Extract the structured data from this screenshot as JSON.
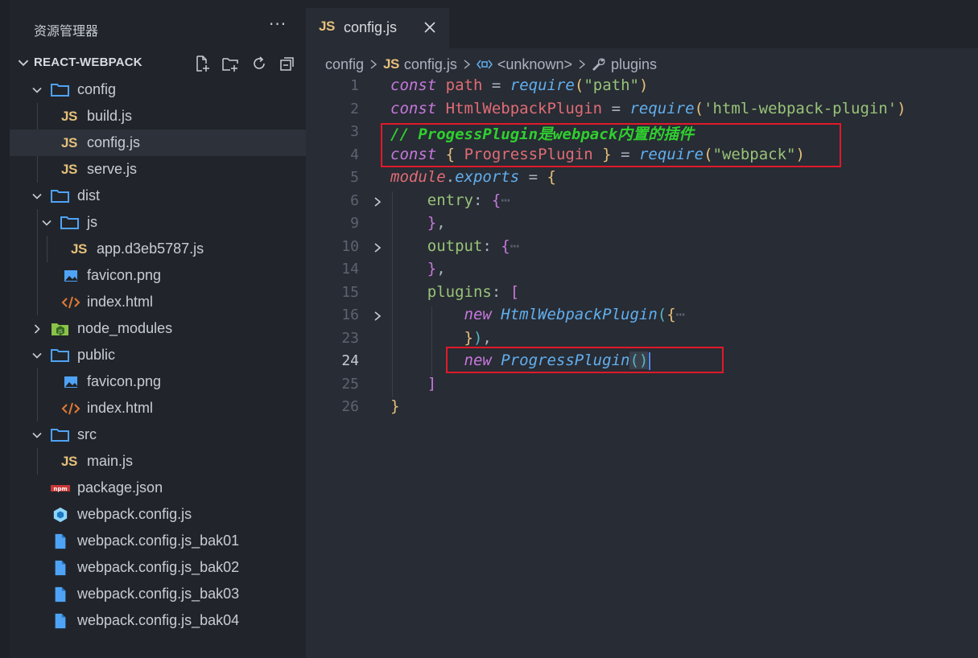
{
  "sidebar": {
    "title": "资源管理器",
    "more": "···",
    "project": "REACT-WEBPACK",
    "tree": [
      {
        "label": "config",
        "type": "folder",
        "depth": 1,
        "open": true
      },
      {
        "label": "build.js",
        "type": "js",
        "depth": 2
      },
      {
        "label": "config.js",
        "type": "js",
        "depth": 2,
        "selected": true
      },
      {
        "label": "serve.js",
        "type": "js",
        "depth": 2
      },
      {
        "label": "dist",
        "type": "folder",
        "depth": 1,
        "open": true
      },
      {
        "label": "js",
        "type": "folder",
        "depth": 2,
        "open": true
      },
      {
        "label": "app.d3eb5787.js",
        "type": "js",
        "depth": 3
      },
      {
        "label": "favicon.png",
        "type": "image",
        "depth": 2
      },
      {
        "label": "index.html",
        "type": "html",
        "depth": 2
      },
      {
        "label": "node_modules",
        "type": "nodefolder",
        "depth": 1,
        "open": false
      },
      {
        "label": "public",
        "type": "folder",
        "depth": 1,
        "open": true
      },
      {
        "label": "favicon.png",
        "type": "image",
        "depth": 2
      },
      {
        "label": "index.html",
        "type": "html",
        "depth": 2
      },
      {
        "label": "src",
        "type": "folder",
        "depth": 1,
        "open": true
      },
      {
        "label": "main.js",
        "type": "js",
        "depth": 2
      },
      {
        "label": "package.json",
        "type": "npm",
        "depth": 1
      },
      {
        "label": "webpack.config.js",
        "type": "webpack",
        "depth": 1
      },
      {
        "label": "webpack.config.js_bak01",
        "type": "file",
        "depth": 1
      },
      {
        "label": "webpack.config.js_bak02",
        "type": "file",
        "depth": 1
      },
      {
        "label": "webpack.config.js_bak03",
        "type": "file",
        "depth": 1
      },
      {
        "label": "webpack.config.js_bak04",
        "type": "file",
        "depth": 1
      }
    ]
  },
  "tab": {
    "icon": "JS",
    "label": "config.js",
    "close": "✕"
  },
  "breadcrumb": {
    "folder": "config",
    "file_icon": "JS",
    "file": "config.js",
    "symbol": "<unknown>",
    "member": "plugins"
  },
  "editor": {
    "lines": [
      {
        "n": "1"
      },
      {
        "n": "2"
      },
      {
        "n": "3"
      },
      {
        "n": "4"
      },
      {
        "n": "5"
      },
      {
        "n": "6"
      },
      {
        "n": "9"
      },
      {
        "n": "10"
      },
      {
        "n": "14"
      },
      {
        "n": "15"
      },
      {
        "n": "16"
      },
      {
        "n": "23"
      },
      {
        "n": "24"
      },
      {
        "n": "25"
      },
      {
        "n": "26"
      }
    ],
    "code": {
      "l1": {
        "kw": "const",
        "name": "path",
        "op": "=",
        "fn": "require",
        "str": "\"path\""
      },
      "l2": {
        "kw": "const",
        "name": "HtmlWebpackPlugin",
        "op": "=",
        "fn": "require",
        "str": "'html-webpack-plugin'"
      },
      "l3": {
        "comment": "// ProgessPlugin是webpack内置的插件"
      },
      "l4": {
        "kw": "const",
        "name": "ProgressPlugin",
        "op": "=",
        "fn": "require",
        "str": "\"webpack\""
      },
      "l5": {
        "obj": "module",
        "prop": "exports",
        "op": "="
      },
      "l6": {
        "key": "entry",
        "ellipsis": "⋯"
      },
      "l10": {
        "key": "output",
        "ellipsis": "⋯"
      },
      "l15": {
        "key": "plugins"
      },
      "l16": {
        "kw": "new",
        "cls": "HtmlWebpackPlugin",
        "ellipsis": "⋯"
      },
      "l24": {
        "kw": "new",
        "cls": "ProgressPlugin"
      }
    }
  },
  "colors": {
    "highlight_box": "#e0192a",
    "keyword": "#c678dd",
    "string": "#98c379",
    "function": "#61afef",
    "variable": "#e06c75",
    "comment": "#2fcf2f"
  }
}
